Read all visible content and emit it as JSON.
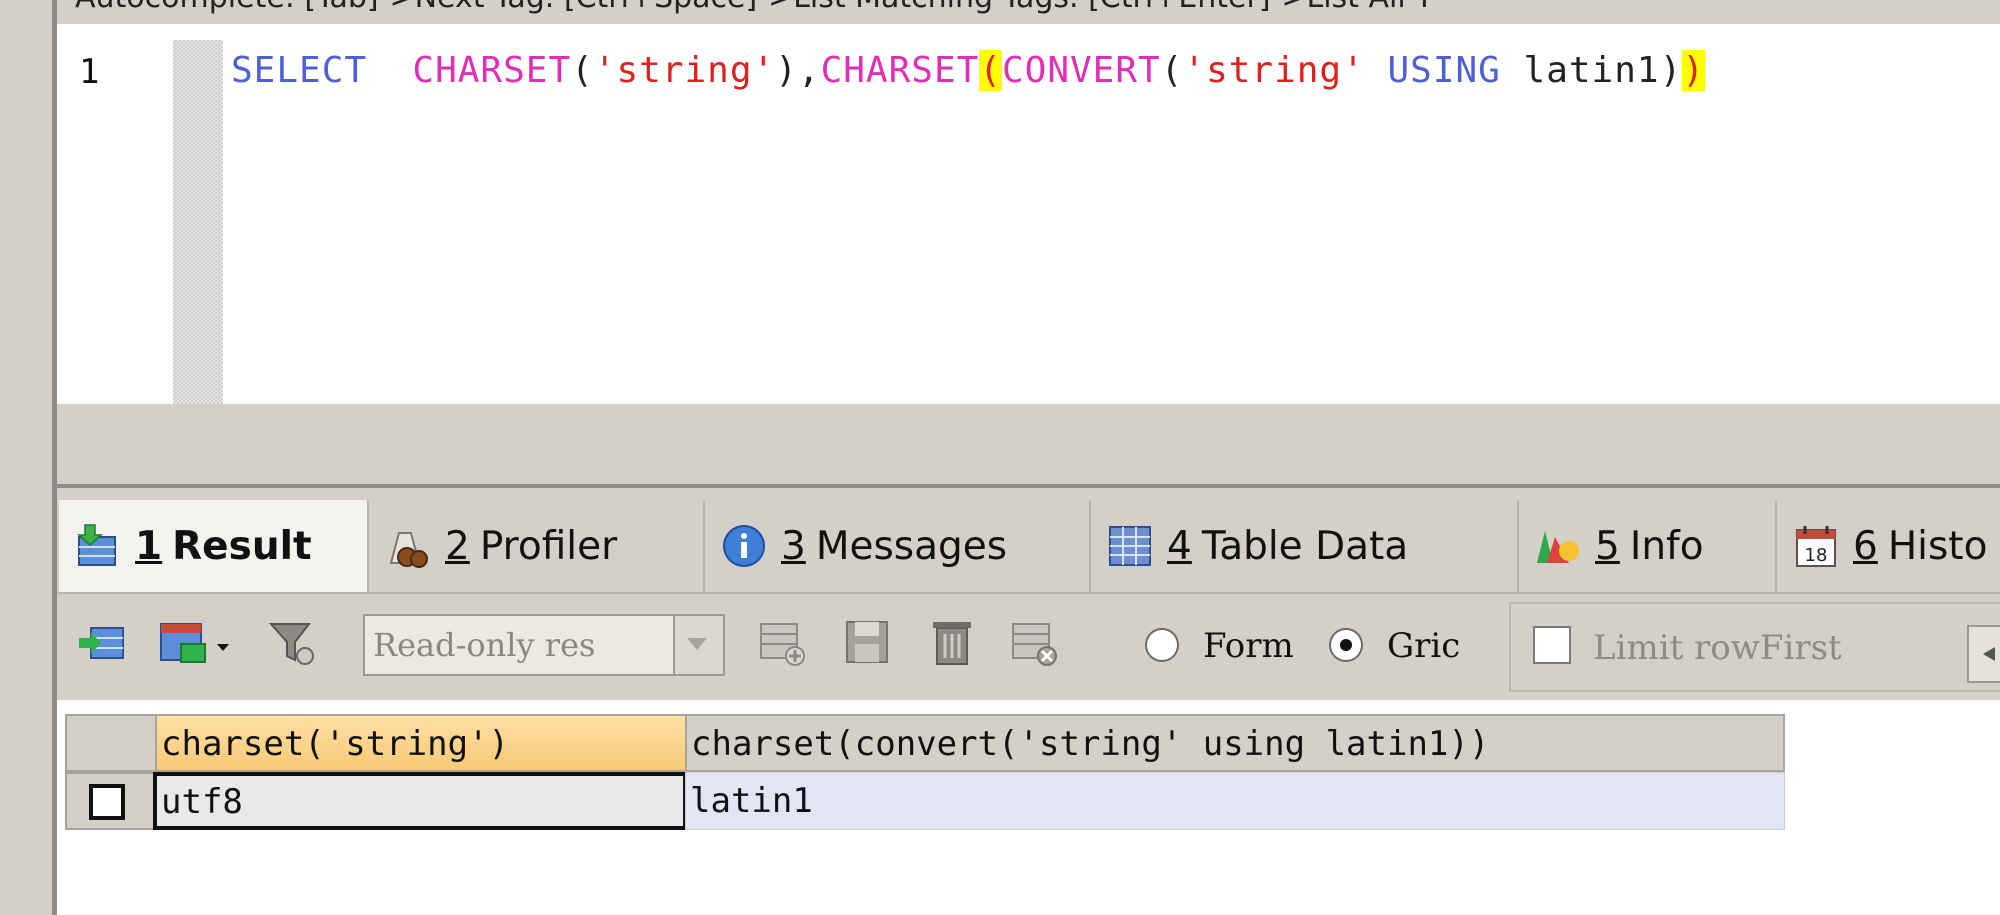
{
  "hint_bar": {
    "text": "Autocomplete: [Tab]->Next Tag. [Ctrl+Space]->List Matching Tags. [Ctrl+Enter]->List All T"
  },
  "editor": {
    "line_number": "1",
    "tokens": {
      "select": "SELECT",
      "charset1": "CHARSET",
      "paren_open1": "(",
      "string1": "'string'",
      "paren_close1": ")",
      "comma": ",",
      "charset2": "CHARSET",
      "paren_open2": "(",
      "convert": "CONVERT",
      "paren_open3": "(",
      "string2": "'string'",
      "using": "USING",
      "latin1": "latin1",
      "paren_close3": ")",
      "paren_close2": ")"
    }
  },
  "tabs": [
    {
      "num": "1",
      "label": "Result",
      "icon": "result-icon"
    },
    {
      "num": "2",
      "label": "Profiler",
      "icon": "profiler-icon"
    },
    {
      "num": "3",
      "label": "Messages",
      "icon": "info-circle-icon"
    },
    {
      "num": "4",
      "label": "Table Data",
      "icon": "table-icon"
    },
    {
      "num": "5",
      "label": "Info",
      "icon": "shapes-icon"
    },
    {
      "num": "6",
      "label": "Histo",
      "icon": "calendar-icon",
      "calendar_day": "18"
    }
  ],
  "toolbar": {
    "readonly_select": "Read-only res",
    "radio_form": "Form",
    "radio_grid": "Gric",
    "limit_label": "Limit rowFirst"
  },
  "grid": {
    "columns": [
      "charset('string')",
      "charset(convert('string' using latin1))"
    ],
    "rows": [
      [
        "utf8",
        "latin1"
      ]
    ]
  }
}
